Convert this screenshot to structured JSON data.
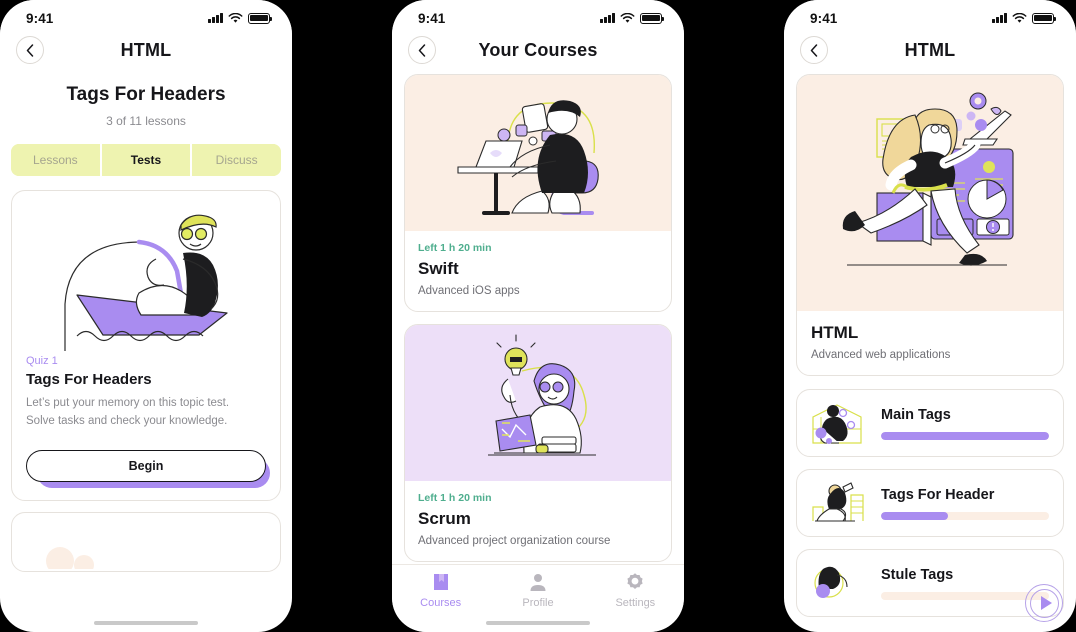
{
  "status_bar": {
    "time": "9:41",
    "signal_icon": "cellular-signal-icon",
    "wifi_icon": "wifi-icon",
    "battery_icon": "battery-icon"
  },
  "screen1": {
    "nav_title": "HTML",
    "back_icon": "chevron-left-icon",
    "heading": "Tags For Headers",
    "subtitle": "3 of 11 lessons",
    "segments": [
      {
        "label": "Lessons",
        "active": false
      },
      {
        "label": "Tests",
        "active": true
      },
      {
        "label": "Discuss",
        "active": false
      }
    ],
    "quiz": {
      "illustration": "fisherman-in-boat-illustration",
      "label": "Quiz 1",
      "title": "Tags For Headers",
      "description_line1": "Let’s put your memory on this topic test.",
      "description_line2": "Solve tasks and check your knowledge.",
      "begin_label": "Begin"
    }
  },
  "screen2": {
    "nav_title": "Your Courses",
    "back_icon": "chevron-left-icon",
    "courses": [
      {
        "illustration": "man-at-desk-with-laptop-illustration",
        "illu_bg": "#fbeee4",
        "left": "Left 1 h 20 min",
        "title": "Swift",
        "description": "Advanced iOS apps"
      },
      {
        "illustration": "woman-with-lightbulb-and-laptop-illustration",
        "illu_bg": "#eddff8",
        "left": "Left 1 h 20 min",
        "title": "Scrum",
        "description": "Advanced project organization course"
      }
    ],
    "tabs": [
      {
        "label": "Courses",
        "icon": "book-icon",
        "active": true
      },
      {
        "label": "Profile",
        "icon": "person-icon",
        "active": false
      },
      {
        "label": "Settings",
        "icon": "gear-icon",
        "active": false
      }
    ]
  },
  "screen3": {
    "nav_title": "HTML",
    "back_icon": "chevron-left-icon",
    "hero": {
      "illustration": "running-woman-with-laptop-and-dashboard-illustration",
      "play_icon": "play-icon",
      "title": "HTML",
      "description": "Advanced web applications"
    },
    "lessons": [
      {
        "thumb": "people-working-thumbnail",
        "title": "Main Tags",
        "progress": 100
      },
      {
        "thumb": "person-reading-thumbnail",
        "title": "Tags For Header",
        "progress": 40
      },
      {
        "thumb": "person-purple-thumbnail",
        "title": "Stule Tags",
        "progress": 0
      }
    ]
  },
  "colors": {
    "purple": "#a98cf0",
    "lime": "#eef3b0",
    "peach": "#fbeee4",
    "lilac": "#eddff8",
    "teal": "#4fae8e",
    "ink": "#16161a"
  }
}
